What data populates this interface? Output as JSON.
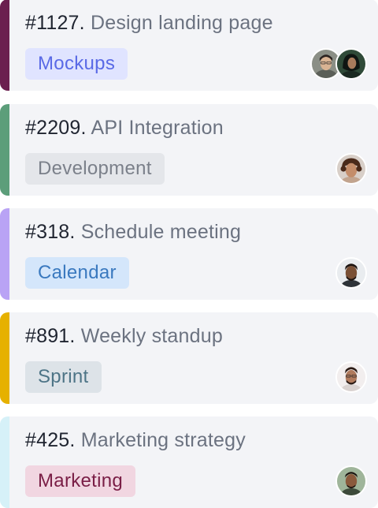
{
  "cards": [
    {
      "number": "#1127.",
      "title": "Design landing page",
      "tag": "Mockups",
      "accent_color": "#6b1f4f",
      "tag_bg": "#e0e4ff",
      "tag_fg": "#5a6ae6"
    },
    {
      "number": "#2209.",
      "title": "API Integration",
      "tag": "Development",
      "accent_color": "#5c9e7a",
      "tag_bg": "#e4e6ea",
      "tag_fg": "#7b808a"
    },
    {
      "number": "#318.",
      "title": "Schedule meeting",
      "tag": "Calendar",
      "accent_color": "#b9a3f5",
      "tag_bg": "#d4e6fb",
      "tag_fg": "#3a79bf"
    },
    {
      "number": "#891.",
      "title": "Weekly standup",
      "tag": "Sprint",
      "accent_color": "#e6b100",
      "tag_bg": "#dde3e8",
      "tag_fg": "#4d7486"
    },
    {
      "number": "#425.",
      "title": "Marketing strategy",
      "tag": "Marketing",
      "accent_color": "#d6f1f8",
      "tag_bg": "#f1d6e1",
      "tag_fg": "#7a1e46"
    }
  ]
}
